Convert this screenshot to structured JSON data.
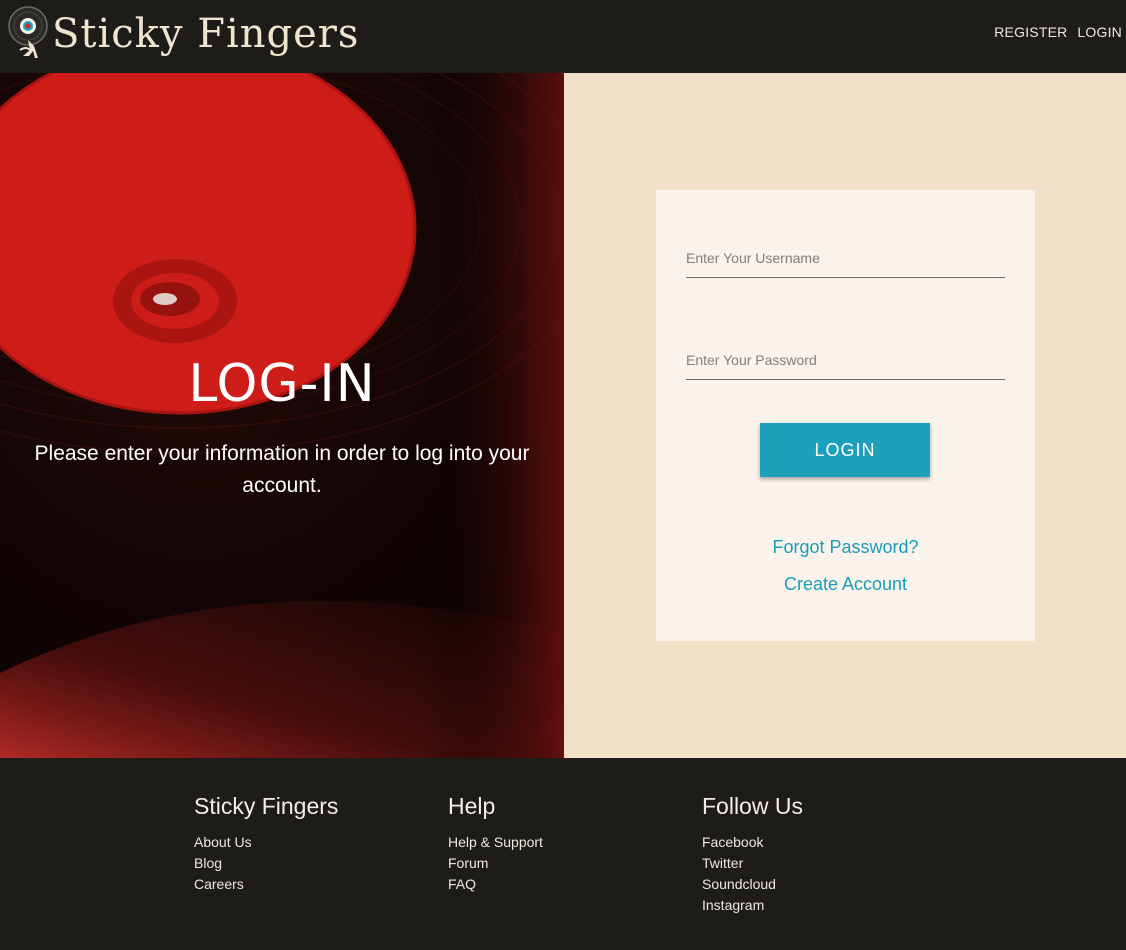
{
  "brand": {
    "name": "Sticky Fingers",
    "logo_icon": "record-character-icon"
  },
  "nav": {
    "register": "REGISTER",
    "login": "LOGIN"
  },
  "hero": {
    "title": "LOG-IN",
    "text": "Please enter your information in order to log into your account."
  },
  "form": {
    "username_placeholder": "Enter Your Username",
    "password_placeholder": "Enter Your Password",
    "login_button": "LOGIN",
    "forgot_password": "Forgot Password?",
    "create_account": "Create Account"
  },
  "footer": {
    "columns": [
      {
        "title": "Sticky Fingers",
        "links": [
          "About Us",
          "Blog",
          "Careers"
        ]
      },
      {
        "title": "Help",
        "links": [
          "Help & Support",
          "Forum",
          "FAQ"
        ]
      },
      {
        "title": "Follow Us",
        "links": [
          "Facebook",
          "Twitter",
          "Soundcloud",
          "Instagram"
        ]
      }
    ]
  },
  "colors": {
    "header_bg": "#1d1c19",
    "panel_bg": "#f2e0c9",
    "card_bg": "#f9f3ec",
    "accent": "#1ea0bd",
    "record_red": "#d9251f"
  }
}
